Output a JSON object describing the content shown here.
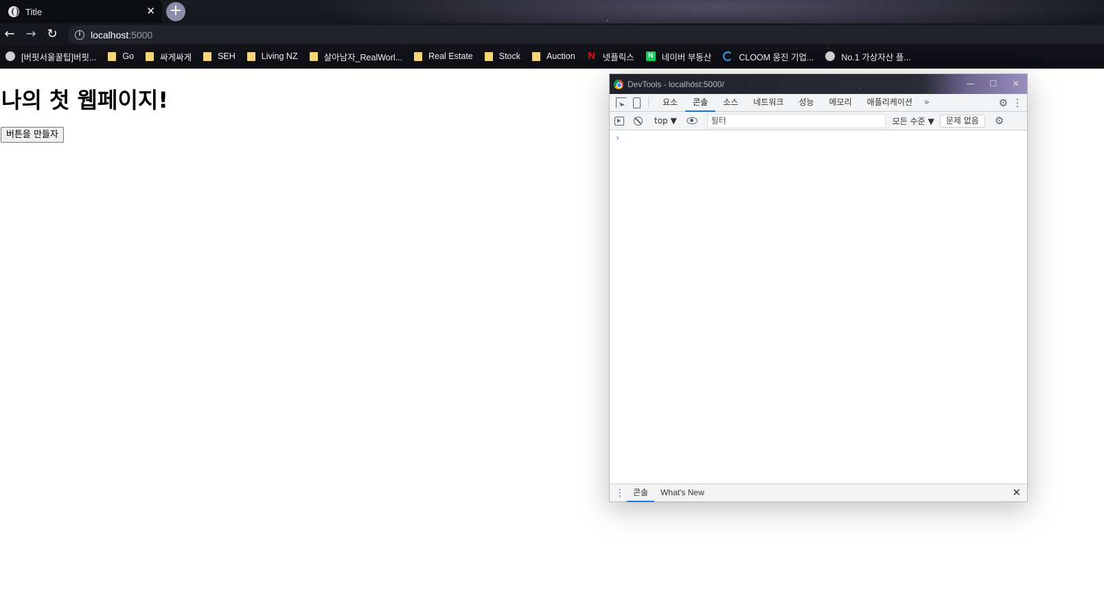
{
  "browser": {
    "tab": {
      "title": "Title",
      "close_glyph": "✕",
      "icon": "globe-icon"
    },
    "new_tab_glyph": "+",
    "nav": {
      "back": "←",
      "forward": "→",
      "reload": "↻"
    },
    "address": {
      "host": "localhost",
      "port": ":5000",
      "info_glyph": "i"
    },
    "bookmarks": [
      {
        "label": "[버핏서울꿀팁]버핏...",
        "icon": "globe-icon"
      },
      {
        "label": "Go",
        "icon": "folder-icon"
      },
      {
        "label": "싸게싸게",
        "icon": "folder-icon"
      },
      {
        "label": "SEH",
        "icon": "folder-icon"
      },
      {
        "label": "Living NZ",
        "icon": "folder-icon"
      },
      {
        "label": "살아남자_RealWorl...",
        "icon": "folder-icon"
      },
      {
        "label": "Real Estate",
        "icon": "folder-icon"
      },
      {
        "label": "Stock",
        "icon": "folder-icon"
      },
      {
        "label": "Auction",
        "icon": "folder-icon"
      },
      {
        "label": "넷플릭스",
        "icon": "netflix-icon",
        "glyph": "N"
      },
      {
        "label": "네이버 부동산",
        "icon": "naver-icon",
        "glyph": "N"
      },
      {
        "label": "CLOOM 웅진 기업...",
        "icon": "cloom-icon"
      },
      {
        "label": "No.1 가상자산 플...",
        "icon": "globe-icon"
      }
    ]
  },
  "page": {
    "heading": "나의 첫 웹페이지!",
    "button_label": "버튼을 만들자"
  },
  "devtools": {
    "window_title": "DevTools - localhost:5000/",
    "window_buttons": {
      "minimize": "—",
      "maximize": "☐",
      "close": "✕"
    },
    "tabs": [
      {
        "label": "요소",
        "active": false
      },
      {
        "label": "콘솔",
        "active": true
      },
      {
        "label": "소스",
        "active": false
      },
      {
        "label": "네트워크",
        "active": false
      },
      {
        "label": "성능",
        "active": false
      },
      {
        "label": "메모리",
        "active": false
      },
      {
        "label": "애플리케이션",
        "active": false
      }
    ],
    "more_tabs_glyph": "»",
    "settings_glyph": "⚙",
    "menu_glyph": "⋮",
    "console_toolbar": {
      "context": "top ▼",
      "filter_placeholder": "필터",
      "levels": "모든 수준 ▼",
      "issues": "문제 없음",
      "settings_glyph": "⚙"
    },
    "console_prompt": "›",
    "drawer": {
      "menu_glyph": "⋮",
      "tabs": [
        {
          "label": "콘솔",
          "active": true
        },
        {
          "label": "What's New",
          "active": false
        }
      ],
      "close_glyph": "✕"
    }
  },
  "colors": {
    "accent": "#1a73e8",
    "devtools_bg": "#f1f3f4",
    "folder": "#f5d57a",
    "netflix": "#e50914",
    "naver": "#19ce60"
  }
}
